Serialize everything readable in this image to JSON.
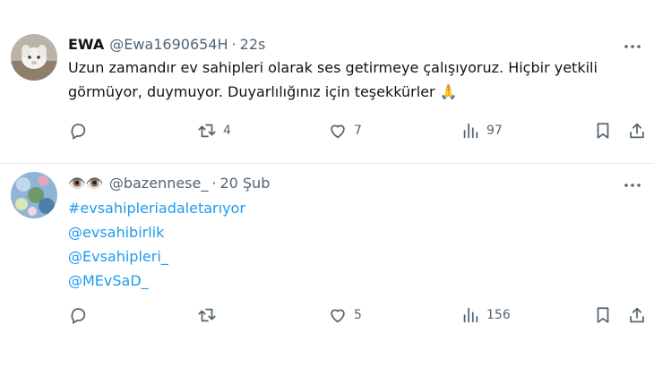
{
  "tweets": [
    {
      "name": "EWA",
      "handle": "@Ewa1690654H",
      "separator": "·",
      "time": "22s",
      "text_lines": [
        "Uzun zamandır ev sahipleri olarak ses getirmeye çalışıyoruz. Hiçbir yetkili",
        "görmüyor, duymuyor. Duyarlılığınız için teşekkürler 🙏"
      ],
      "actions": {
        "reply": "",
        "retweet": "4",
        "like": "7",
        "views": "97"
      }
    },
    {
      "name": "👁️👁️",
      "handle": "@bazennese_",
      "separator": "·",
      "time": "20 Şub",
      "link_lines": [
        "#evsahipleriadaletarıyor",
        "@evsahibirlik",
        "@Evsahipleri_",
        "@MEvSaD_"
      ],
      "actions": {
        "reply": "",
        "retweet": "",
        "like": "5",
        "views": "156"
      }
    }
  ],
  "colors": {
    "link": "#1d9bf0",
    "muted": "#536471",
    "text": "#0f1419"
  },
  "icons": [
    "reply-icon",
    "retweet-icon",
    "like-icon",
    "views-icon",
    "bookmark-icon",
    "share-icon",
    "more-icon"
  ]
}
